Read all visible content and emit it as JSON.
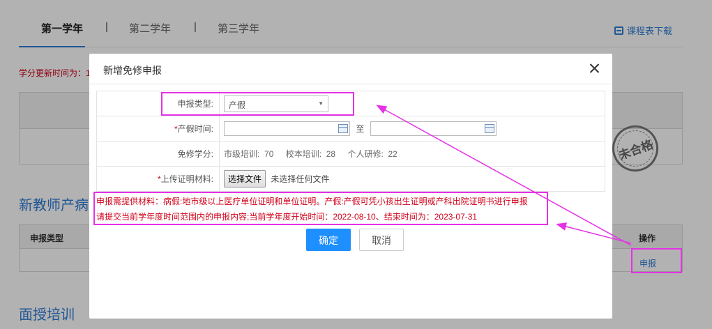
{
  "tabs": [
    {
      "label": "第一学年",
      "active": true
    },
    {
      "label": "第二学年",
      "active": false
    },
    {
      "label": "第三学年",
      "active": false
    }
  ],
  "tab_separator": "|",
  "download_label": "课程表下载",
  "credit_update_note": "学分更新时间为：1",
  "stamp_text": "未合格",
  "section_new_teacher": "新教师产病",
  "section_face_training": "面授培训",
  "bg_table": {
    "col_type": "申报类型",
    "col_operation": "操作",
    "apply_link": "申报"
  },
  "modal": {
    "title": "新增免修申报",
    "rows": {
      "type": {
        "label": "申报类型:",
        "value": "产假"
      },
      "leave_time": {
        "required": "*",
        "label": "产假时间:",
        "separator": "至"
      },
      "credits": {
        "label": "免修学分:",
        "items": [
          {
            "label": "市级培训:",
            "value": "70"
          },
          {
            "label": "校本培训:",
            "value": "28"
          },
          {
            "label": "个人研修:",
            "value": "22"
          }
        ]
      },
      "upload": {
        "required": "*",
        "label": "上传证明材料:",
        "button": "选择文件",
        "status": "未选择任何文件"
      }
    },
    "notes": [
      "申报需提供材料：病假:地市级以上医疗单位证明和单位证明。产假:产假可凭小孩出生证明或产科出院证明书进行申报",
      "请提交当前学年度时间范围内的申报内容;当前学年度开始时间：2022-08-10、结束时间为：2023-07-31"
    ],
    "confirm": "确定",
    "cancel": "取消"
  },
  "colors": {
    "accent": "#2f7bd6",
    "primary_button": "#1e8fff",
    "warning_text": "#d0021b",
    "annotation": "#e532e5"
  }
}
